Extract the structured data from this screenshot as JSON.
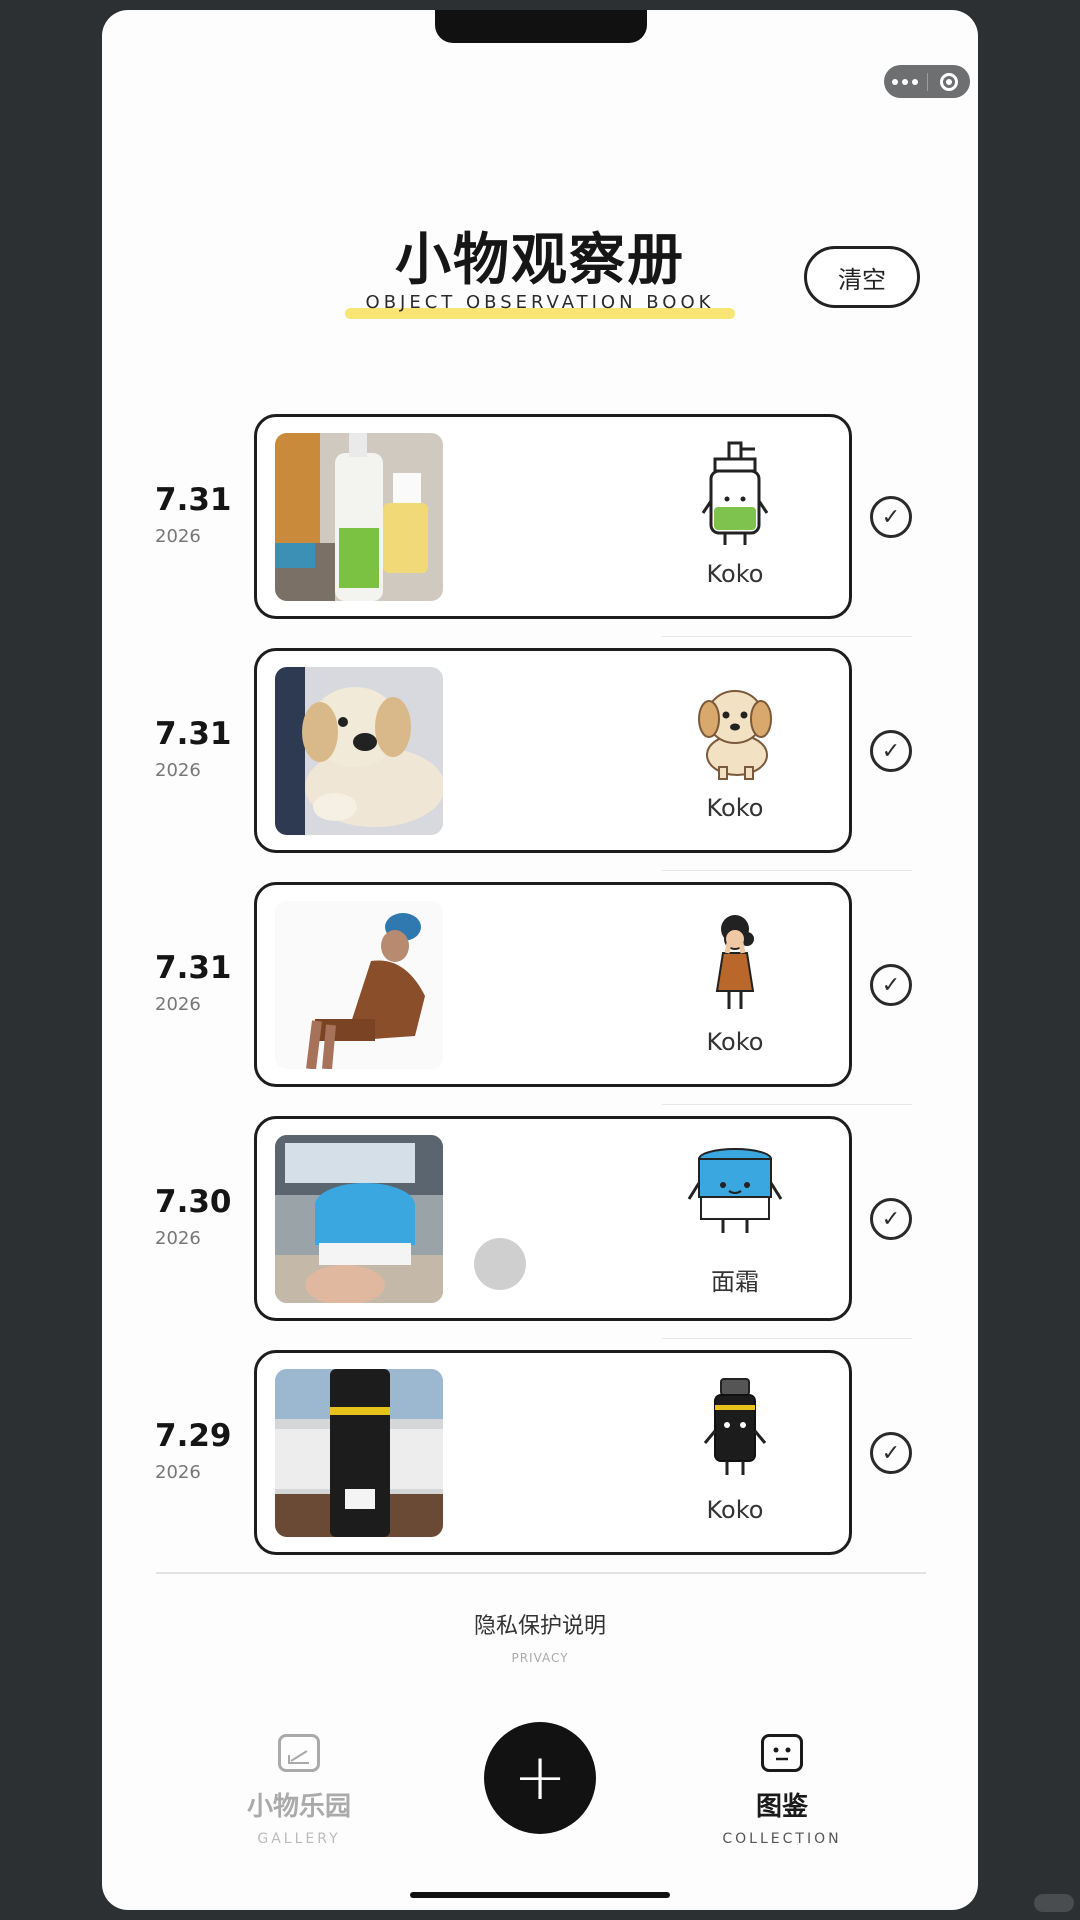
{
  "header": {
    "title": "小物观察册",
    "subtitle": "OBJECT OBSERVATION BOOK",
    "clear_label": "清空"
  },
  "entries": [
    {
      "date": "7.31",
      "year": "2026",
      "name": "Koko",
      "photo": "lotion-bottle-photo",
      "sticker": "bottle-sticker-icon"
    },
    {
      "date": "7.31",
      "year": "2026",
      "name": "Koko",
      "photo": "puppy-plush-photo",
      "sticker": "puppy-sticker-icon"
    },
    {
      "date": "7.31",
      "year": "2026",
      "name": "Koko",
      "photo": "seated-person-photo",
      "sticker": "girl-sticker-icon"
    },
    {
      "date": "7.30",
      "year": "2026",
      "name": "面霜",
      "photo": "cream-jar-photo",
      "sticker": "cream-jar-sticker-icon"
    },
    {
      "date": "7.29",
      "year": "2026",
      "name": "Koko",
      "photo": "black-bottle-photo",
      "sticker": "black-bottle-sticker-icon"
    }
  ],
  "footer": {
    "privacy_label": "隐私保护说明",
    "privacy_sub": "PRIVACY"
  },
  "tabbar": {
    "gallery_label": "小物乐园",
    "gallery_sub": "GALLERY",
    "add_label": "+",
    "collection_label": "图鉴",
    "collection_sub": "COLLECTION"
  },
  "colors": {
    "accent_highlight": "#f7e15a",
    "ink": "#161616",
    "background": "#fdfdfd"
  }
}
